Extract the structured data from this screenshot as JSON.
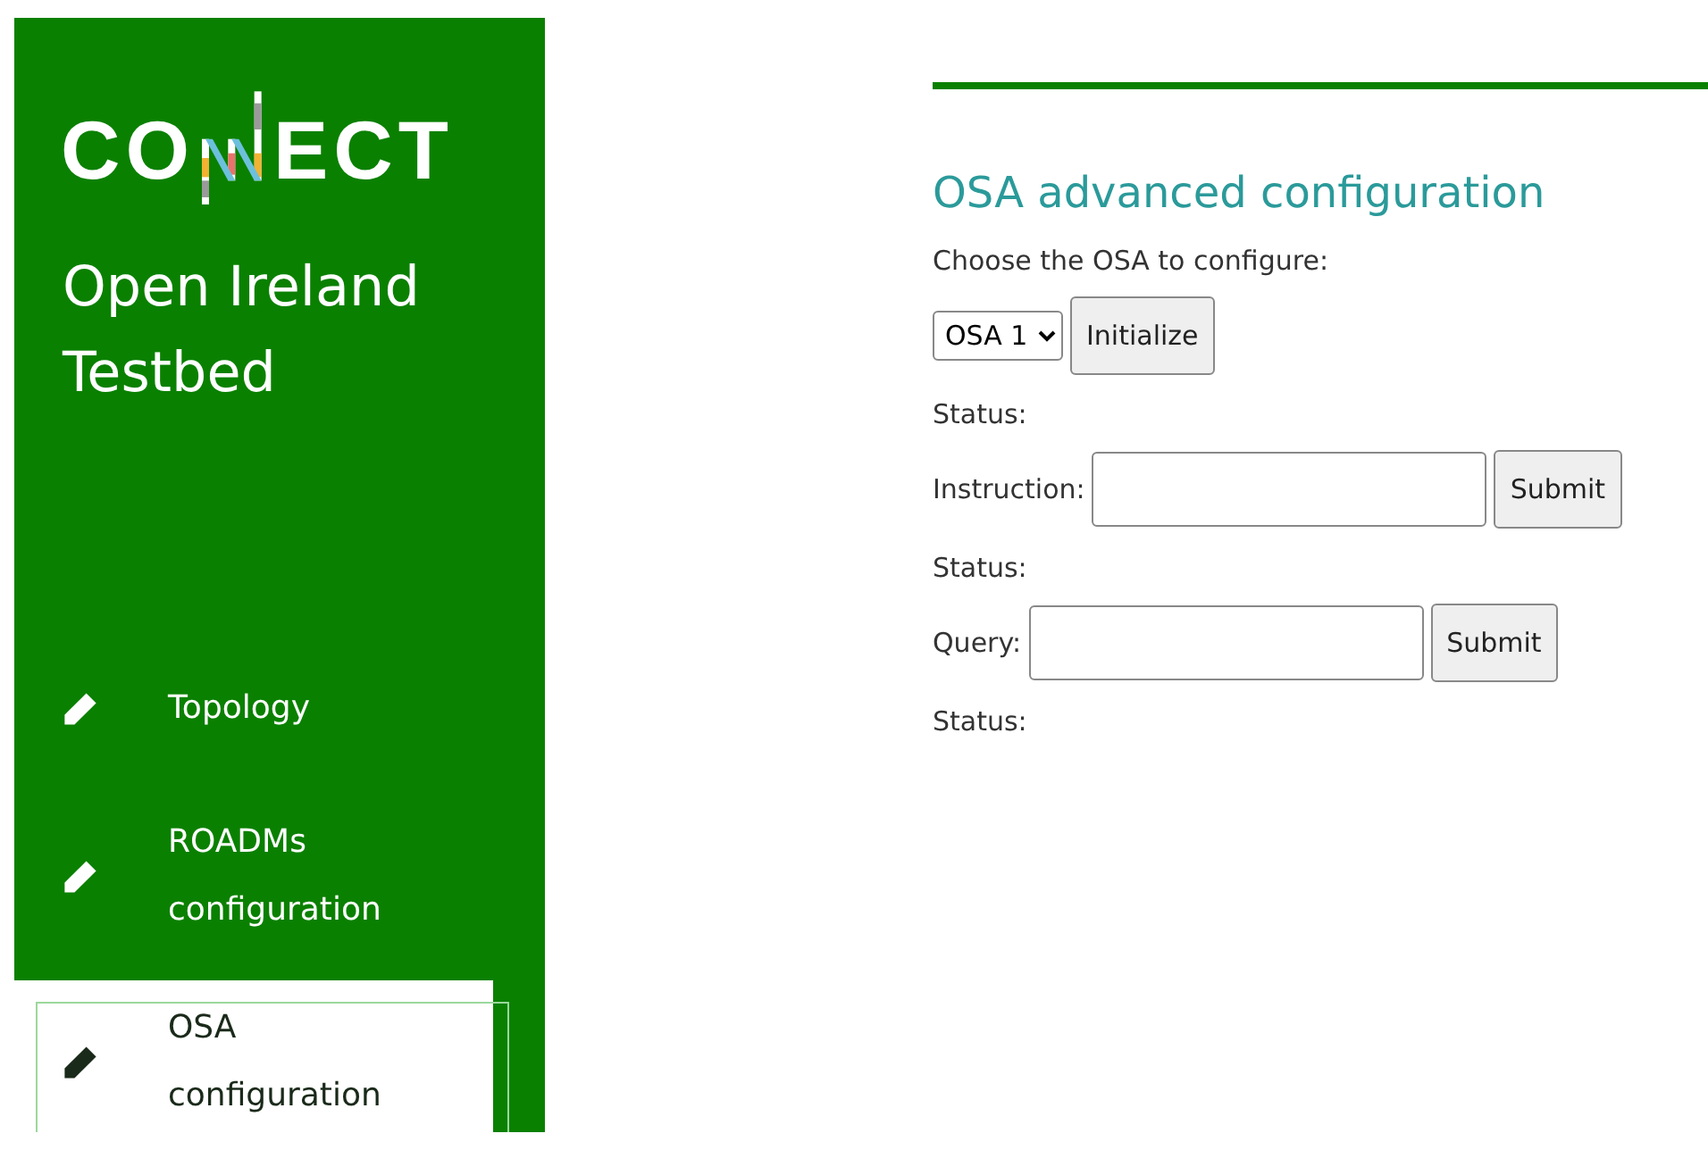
{
  "logo": {
    "left": "CO",
    "right": "ECT"
  },
  "subtitle": "Open Ireland Testbed",
  "nav": [
    {
      "label": "Topology",
      "selected": false
    },
    {
      "label": "ROADMs configuration",
      "selected": false
    },
    {
      "label": "OSA configuration",
      "selected": true
    }
  ],
  "title": "OSA advanced configuration",
  "choose_label": "Choose the OSA to configure:",
  "osa_select": {
    "value": "OSA 1"
  },
  "initialize_button": "Initialize",
  "status_1": "Status:",
  "instruction": {
    "label": "Instruction:",
    "button": "Submit"
  },
  "status_2": "Status:",
  "query": {
    "label": "Query:",
    "button": "Submit"
  },
  "status_3": "Status:"
}
